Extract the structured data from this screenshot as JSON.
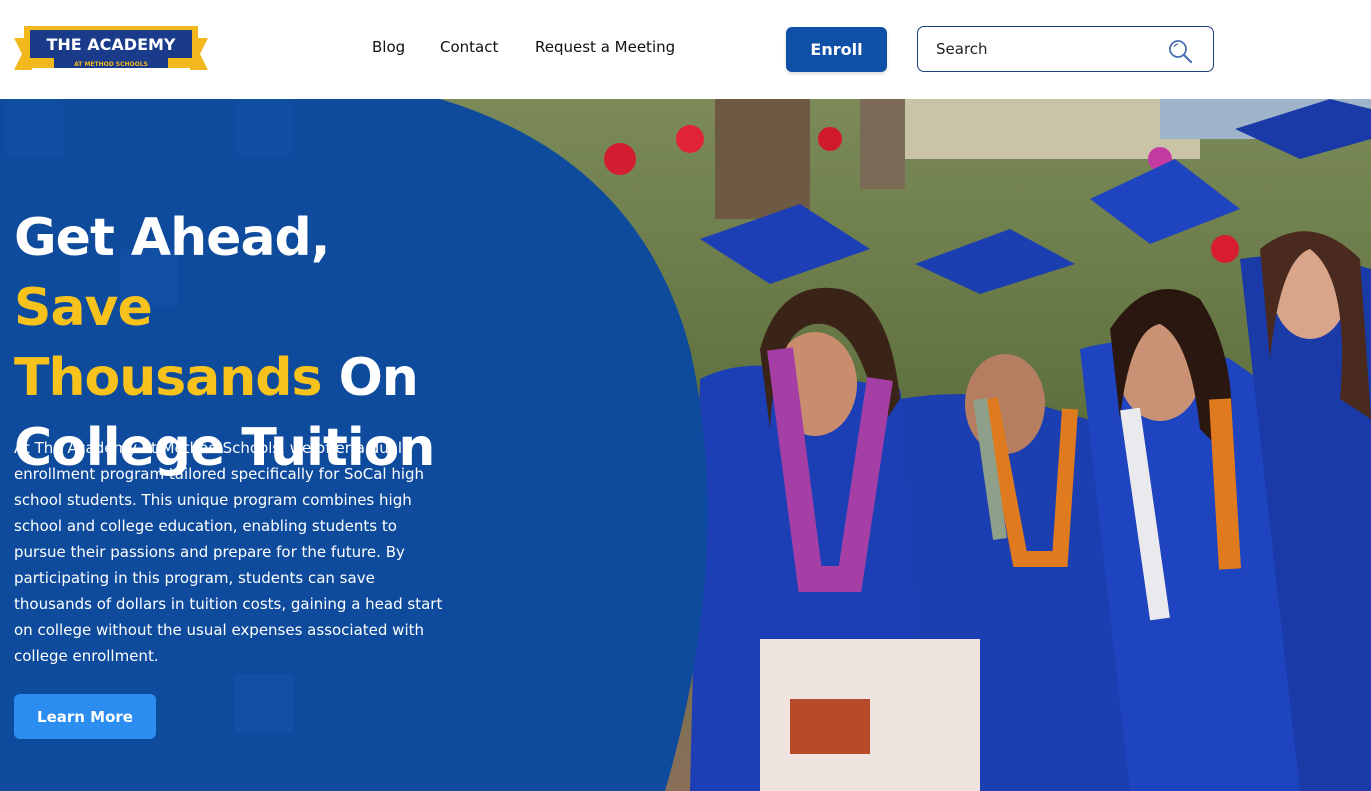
{
  "logo": {
    "title": "THE ACADEMY",
    "subtitle": "AT METHOD SCHOOLS"
  },
  "nav": {
    "items": [
      "Blog",
      "Contact",
      "Request a Meeting"
    ]
  },
  "header": {
    "enroll_label": "Enroll",
    "search_placeholder": "Search"
  },
  "hero": {
    "headline_part1": "Get Ahead, ",
    "headline_accent": "Save Thousands",
    "headline_part2": " On College Tuition",
    "body": "At The Academy at Method Schools, we offer a dual enrollment program tailored specifically for SoCal high school students. This unique program combines high school and college education, enabling students to pursue their passions and prepare for the future. By participating in this program, students can save thousands of dollars in tuition costs, gaining a head start on college without the usual expenses associated with college enrollment.",
    "cta_label": "Learn More"
  },
  "colors": {
    "brand_blue": "#0f4fa6",
    "panel_blue": "#0e4b9d",
    "accent_yellow": "#f7c21c",
    "button_light_blue": "#2b8df0"
  }
}
